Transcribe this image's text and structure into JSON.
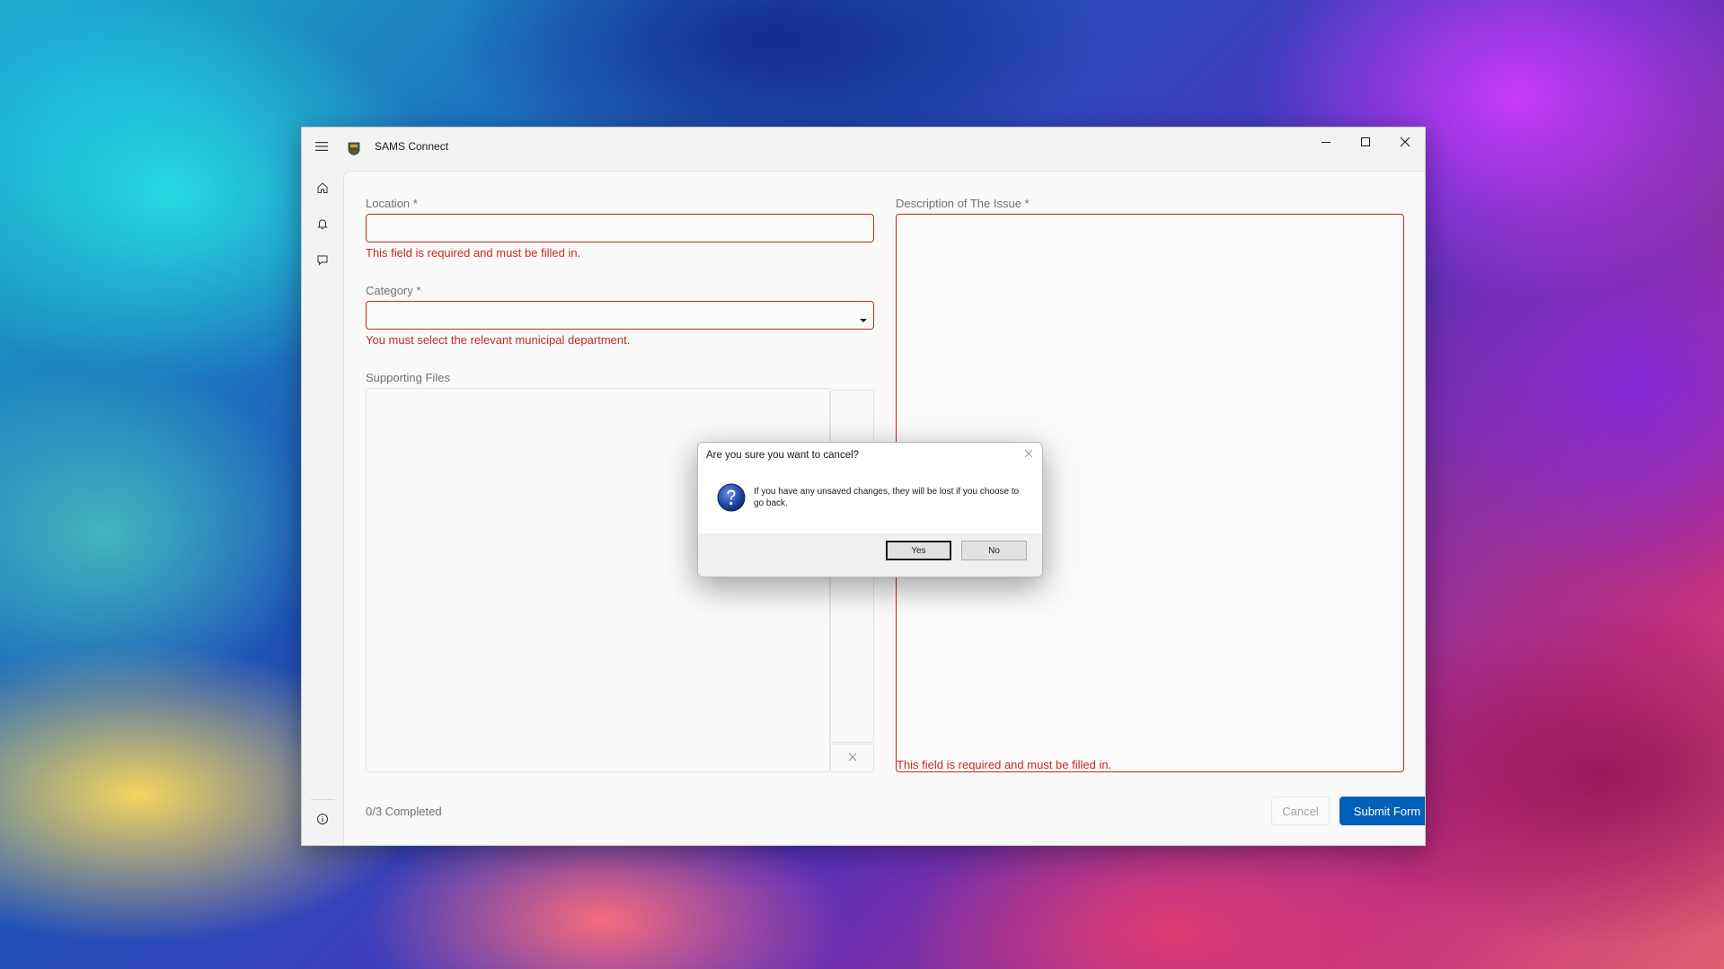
{
  "app": {
    "title": "SAMS Connect"
  },
  "nav": {
    "items": [
      {
        "icon": "home-icon"
      },
      {
        "icon": "bell-icon"
      },
      {
        "icon": "chat-icon"
      }
    ],
    "bottom_icon": "info-icon"
  },
  "form": {
    "location": {
      "label": "Location *",
      "value": "",
      "error": "This field is required and must be filled in."
    },
    "category": {
      "label": "Category *",
      "value": "",
      "error": "You must select the relevant municipal department."
    },
    "supporting_files": {
      "label": "Supporting Files"
    },
    "description": {
      "label": "Description of The Issue *",
      "value": "",
      "error": "This field is required and must be filled in."
    },
    "progress": "0/3  Completed",
    "cancel_label": "Cancel",
    "submit_label": "Submit Form"
  },
  "dialog": {
    "title": "Are you sure you want to cancel?",
    "message": "If you have any unsaved changes, they will be lost if you choose to go back.",
    "icon": "question-icon",
    "yes_label": "Yes",
    "no_label": "No"
  },
  "colors": {
    "error": "#c42b1c",
    "accent": "#005fb8"
  }
}
